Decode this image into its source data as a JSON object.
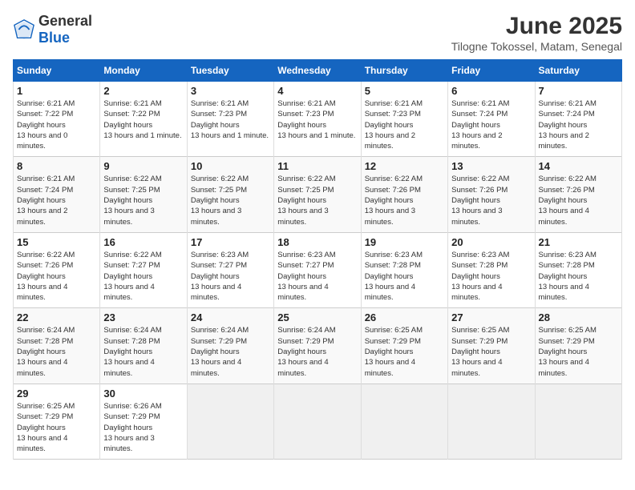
{
  "header": {
    "logo_general": "General",
    "logo_blue": "Blue",
    "title": "June 2025",
    "subtitle": "Tilogne Tokossel, Matam, Senegal"
  },
  "calendar": {
    "days_of_week": [
      "Sunday",
      "Monday",
      "Tuesday",
      "Wednesday",
      "Thursday",
      "Friday",
      "Saturday"
    ],
    "weeks": [
      [
        null,
        {
          "day": "2",
          "sunrise": "6:21 AM",
          "sunset": "7:22 PM",
          "daylight": "13 hours and 1 minute."
        },
        {
          "day": "3",
          "sunrise": "6:21 AM",
          "sunset": "7:23 PM",
          "daylight": "13 hours and 1 minute."
        },
        {
          "day": "4",
          "sunrise": "6:21 AM",
          "sunset": "7:23 PM",
          "daylight": "13 hours and 1 minute."
        },
        {
          "day": "5",
          "sunrise": "6:21 AM",
          "sunset": "7:23 PM",
          "daylight": "13 hours and 2 minutes."
        },
        {
          "day": "6",
          "sunrise": "6:21 AM",
          "sunset": "7:24 PM",
          "daylight": "13 hours and 2 minutes."
        },
        {
          "day": "7",
          "sunrise": "6:21 AM",
          "sunset": "7:24 PM",
          "daylight": "13 hours and 2 minutes."
        }
      ],
      [
        {
          "day": "1",
          "sunrise": "6:21 AM",
          "sunset": "7:22 PM",
          "daylight": "13 hours and 0 minutes."
        },
        {
          "day": "9",
          "sunrise": "6:22 AM",
          "sunset": "7:25 PM",
          "daylight": "13 hours and 3 minutes."
        },
        {
          "day": "10",
          "sunrise": "6:22 AM",
          "sunset": "7:25 PM",
          "daylight": "13 hours and 3 minutes."
        },
        {
          "day": "11",
          "sunrise": "6:22 AM",
          "sunset": "7:25 PM",
          "daylight": "13 hours and 3 minutes."
        },
        {
          "day": "12",
          "sunrise": "6:22 AM",
          "sunset": "7:26 PM",
          "daylight": "13 hours and 3 minutes."
        },
        {
          "day": "13",
          "sunrise": "6:22 AM",
          "sunset": "7:26 PM",
          "daylight": "13 hours and 3 minutes."
        },
        {
          "day": "14",
          "sunrise": "6:22 AM",
          "sunset": "7:26 PM",
          "daylight": "13 hours and 4 minutes."
        }
      ],
      [
        {
          "day": "8",
          "sunrise": "6:21 AM",
          "sunset": "7:24 PM",
          "daylight": "13 hours and 2 minutes."
        },
        {
          "day": "16",
          "sunrise": "6:22 AM",
          "sunset": "7:27 PM",
          "daylight": "13 hours and 4 minutes."
        },
        {
          "day": "17",
          "sunrise": "6:23 AM",
          "sunset": "7:27 PM",
          "daylight": "13 hours and 4 minutes."
        },
        {
          "day": "18",
          "sunrise": "6:23 AM",
          "sunset": "7:27 PM",
          "daylight": "13 hours and 4 minutes."
        },
        {
          "day": "19",
          "sunrise": "6:23 AM",
          "sunset": "7:28 PM",
          "daylight": "13 hours and 4 minutes."
        },
        {
          "day": "20",
          "sunrise": "6:23 AM",
          "sunset": "7:28 PM",
          "daylight": "13 hours and 4 minutes."
        },
        {
          "day": "21",
          "sunrise": "6:23 AM",
          "sunset": "7:28 PM",
          "daylight": "13 hours and 4 minutes."
        }
      ],
      [
        {
          "day": "15",
          "sunrise": "6:22 AM",
          "sunset": "7:26 PM",
          "daylight": "13 hours and 4 minutes."
        },
        {
          "day": "23",
          "sunrise": "6:24 AM",
          "sunset": "7:28 PM",
          "daylight": "13 hours and 4 minutes."
        },
        {
          "day": "24",
          "sunrise": "6:24 AM",
          "sunset": "7:29 PM",
          "daylight": "13 hours and 4 minutes."
        },
        {
          "day": "25",
          "sunrise": "6:24 AM",
          "sunset": "7:29 PM",
          "daylight": "13 hours and 4 minutes."
        },
        {
          "day": "26",
          "sunrise": "6:25 AM",
          "sunset": "7:29 PM",
          "daylight": "13 hours and 4 minutes."
        },
        {
          "day": "27",
          "sunrise": "6:25 AM",
          "sunset": "7:29 PM",
          "daylight": "13 hours and 4 minutes."
        },
        {
          "day": "28",
          "sunrise": "6:25 AM",
          "sunset": "7:29 PM",
          "daylight": "13 hours and 4 minutes."
        }
      ],
      [
        {
          "day": "22",
          "sunrise": "6:24 AM",
          "sunset": "7:28 PM",
          "daylight": "13 hours and 4 minutes."
        },
        {
          "day": "30",
          "sunrise": "6:26 AM",
          "sunset": "7:29 PM",
          "daylight": "13 hours and 3 minutes."
        },
        null,
        null,
        null,
        null,
        null
      ],
      [
        {
          "day": "29",
          "sunrise": "6:25 AM",
          "sunset": "7:29 PM",
          "daylight": "13 hours and 4 minutes."
        },
        null,
        null,
        null,
        null,
        null,
        null
      ]
    ]
  }
}
